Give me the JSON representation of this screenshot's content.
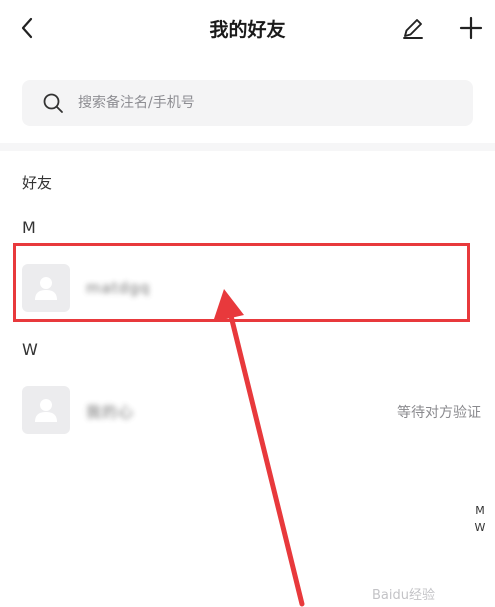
{
  "header": {
    "title": "我的好友",
    "back_icon": "chevron-left-icon",
    "edit_icon": "pencil-icon",
    "add_icon": "plus-icon"
  },
  "search": {
    "placeholder": "搜索备注名/手机号",
    "value": "",
    "icon": "search-icon"
  },
  "friends": {
    "section_label": "好友",
    "groups": [
      {
        "letter": "M",
        "items": [
          {
            "name": "matdgq",
            "status": ""
          }
        ]
      },
      {
        "letter": "W",
        "items": [
          {
            "name": "我的心",
            "status": "等待对方验证"
          }
        ]
      }
    ]
  },
  "index_bar": [
    "M",
    "W"
  ],
  "annotation": {
    "box_color": "#e8393c",
    "arrow_color": "#e8393c"
  },
  "watermark": "Baidu经验",
  "colors": {
    "search_bg": "#f4f4f5",
    "avatar_bg": "#ececee",
    "text_muted": "#8a8a8e"
  }
}
